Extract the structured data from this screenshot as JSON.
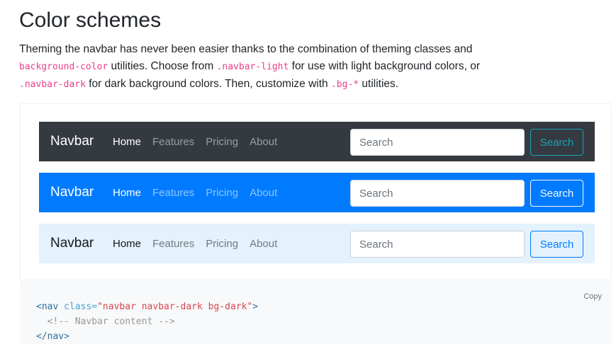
{
  "heading": "Color schemes",
  "intro": {
    "part1": "Theming the navbar has never been easier thanks to the combination of theming classes and ",
    "code1": "background-color",
    "part2": " utilities. Choose from ",
    "code2": ".navbar-light",
    "part3": " for use with light background colors, or ",
    "code3": ".navbar-dark",
    "part4": " for dark background colors. Then, customize with ",
    "code4": ".bg-*",
    "part5": " utilities."
  },
  "navbars": [
    {
      "variant": "dark",
      "background": "#343a40",
      "brand": "Navbar",
      "links": [
        "Home",
        "Features",
        "Pricing",
        "About"
      ],
      "search_placeholder": "Search",
      "search_button": "Search",
      "button_color": "#17a2b8"
    },
    {
      "variant": "primary",
      "background": "#007bff",
      "brand": "Navbar",
      "links": [
        "Home",
        "Features",
        "Pricing",
        "About"
      ],
      "search_placeholder": "Search",
      "search_button": "Search",
      "button_color": "#f8f9fa"
    },
    {
      "variant": "light",
      "background": "#e3f2fd",
      "brand": "Navbar",
      "links": [
        "Home",
        "Features",
        "Pricing",
        "About"
      ],
      "search_placeholder": "Search",
      "search_button": "Search",
      "button_color": "#007bff"
    }
  ],
  "code_block": {
    "copy_label": "Copy",
    "open_lt": "<",
    "tag_name": "nav",
    "attr_name": " class=",
    "attr_value": "\"navbar navbar-dark bg-dark\"",
    "open_gt": ">",
    "comment": "  <!-- Navbar content -->",
    "close_tag": "</nav>"
  }
}
